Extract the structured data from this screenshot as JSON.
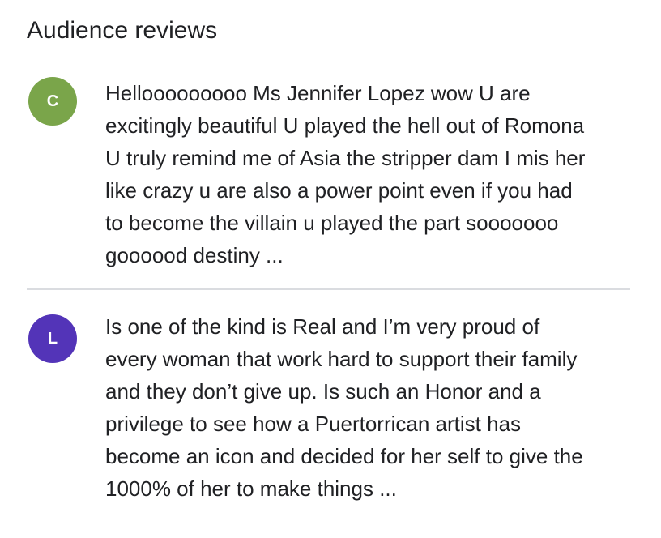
{
  "section": {
    "title": "Audience reviews"
  },
  "reviews": [
    {
      "avatar_letter": "C",
      "avatar_color": "#7aa54a",
      "text": "Hellooooooooo Ms Jennifer Lopez wow U are\nexcitingly beautiful U played the hell out of Romona\nU truly remind me of Asia the stripper dam I mis her\nlike crazy u are also a power point even if you had\nto become the villain u played the part sooooooo\ngoooood destiny ..."
    },
    {
      "avatar_letter": "L",
      "avatar_color": "#5334b8",
      "text": "Is one of the kind is Real and I’m very proud of\nevery woman that work hard to support their family\nand they don’t give up. Is such an Honor and a\nprivilege to see how a Puertorrican artist has\nbecome an icon and decided for her self to give the\n1000% of her to make things ..."
    }
  ]
}
